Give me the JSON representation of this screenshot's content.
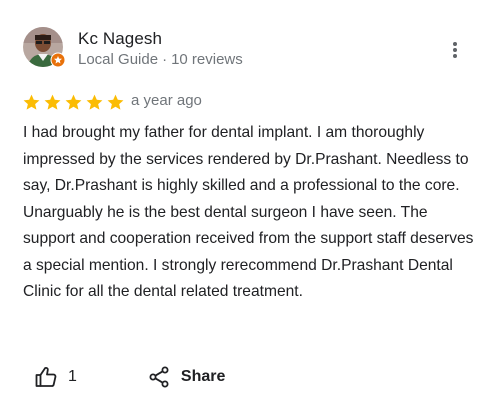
{
  "author": {
    "name": "Kc Nagesh",
    "badge_label": "Local Guide",
    "reviews_count": "10 reviews",
    "separator": "·"
  },
  "review": {
    "rating": 5,
    "rating_max": 5,
    "time": "a year ago",
    "text": "I had brought my father for dental implant. I am thoroughly impressed by the services rendered by Dr.Prashant. Needless to say, Dr.Prashant is highly skilled and a professional to the core. Unarguably he is the best dental surgeon I have seen. The support and cooperation received from the support staff deserves a special mention. I strongly rerecommend Dr.Prashant Dental Clinic for all the dental related treatment."
  },
  "actions": {
    "like_count": "1",
    "share_label": "Share"
  },
  "icons": {
    "more": "more-vert-icon",
    "star": "star-icon",
    "like": "thumb-up-icon",
    "share": "share-icon",
    "badge": "local-guide-badge-icon"
  },
  "colors": {
    "star": "#fbbc04",
    "badge": "#e8710a",
    "secondary_text": "#70757a",
    "primary_text": "#202124"
  }
}
